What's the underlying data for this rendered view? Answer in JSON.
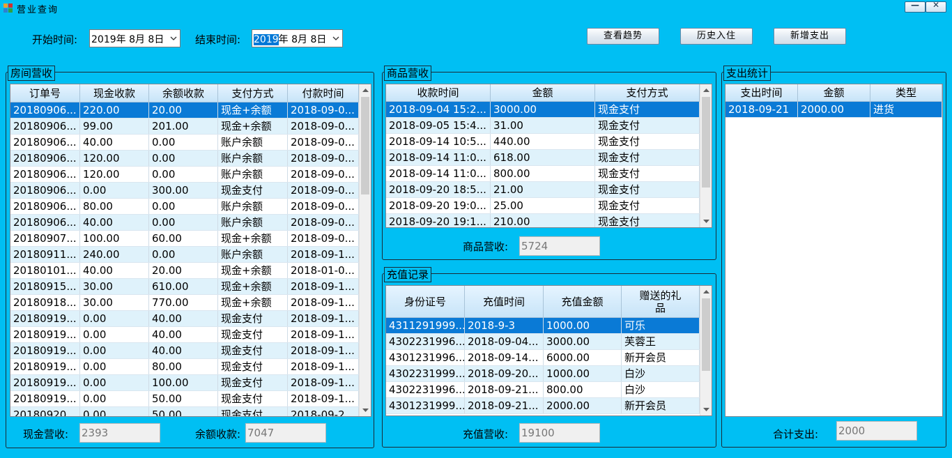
{
  "window": {
    "title": "营业查询",
    "icon": "app-icon",
    "min_icon": "minimize-icon",
    "close_icon": "close-icon"
  },
  "filters": {
    "start_label": "开始时间:",
    "start_value_sel": "",
    "start_value": "2019年  8月  8日",
    "end_label": "结束时间:",
    "end_value_sel": "2019",
    "end_value": "年  8月  8日"
  },
  "buttons": {
    "view_trend": "查看趋势",
    "history_checkin": "历史入住",
    "add_expense": "新增支出"
  },
  "room_revenue": {
    "title": "房间营收",
    "columns": [
      "订单号",
      "现金收款",
      "余额收款",
      "支付方式",
      "付款时间"
    ],
    "rows": [
      [
        "20180906...",
        "220.00",
        "20.00",
        "现金+余额",
        "2018-09-0..."
      ],
      [
        "20180906...",
        "99.00",
        "201.00",
        "现金+余额",
        "2018-09-0..."
      ],
      [
        "20180906...",
        "40.00",
        "0.00",
        "账户余额",
        "2018-09-0..."
      ],
      [
        "20180906...",
        "120.00",
        "0.00",
        "账户余额",
        "2018-09-0..."
      ],
      [
        "20180906...",
        "120.00",
        "0.00",
        "账户余额",
        "2018-09-0..."
      ],
      [
        "20180906...",
        "0.00",
        "300.00",
        "现金支付",
        "2018-09-0..."
      ],
      [
        "20180906...",
        "80.00",
        "0.00",
        "账户余额",
        "2018-09-0..."
      ],
      [
        "20180906...",
        "40.00",
        "0.00",
        "账户余额",
        "2018-09-0..."
      ],
      [
        "20180907...",
        "100.00",
        "60.00",
        "现金+余额",
        "2018-09-0..."
      ],
      [
        "20180911...",
        "240.00",
        "0.00",
        "账户余额",
        "2018-09-1..."
      ],
      [
        "20180101...",
        "40.00",
        "20.00",
        "现金+余额",
        "2018-01-0..."
      ],
      [
        "20180915...",
        "30.00",
        "610.00",
        "现金+余额",
        "2018-09-1..."
      ],
      [
        "20180918...",
        "30.00",
        "770.00",
        "现金+余额",
        "2018-09-1..."
      ],
      [
        "20180919...",
        "0.00",
        "40.00",
        "现金支付",
        "2018-09-1..."
      ],
      [
        "20180919...",
        "0.00",
        "40.00",
        "现金支付",
        "2018-09-1..."
      ],
      [
        "20180919...",
        "0.00",
        "40.00",
        "现金支付",
        "2018-09-1..."
      ],
      [
        "20180919...",
        "0.00",
        "80.00",
        "现金支付",
        "2018-09-1..."
      ],
      [
        "20180919...",
        "0.00",
        "100.00",
        "现金支付",
        "2018-09-1..."
      ],
      [
        "20180919...",
        "0.00",
        "50.00",
        "现金支付",
        "2018-09-1..."
      ],
      [
        "20180920...",
        "0.00",
        "50.00",
        "现金支付",
        "2018-09-2..."
      ]
    ],
    "cash_label": "现金营收:",
    "cash_value": "2393",
    "balance_label": "余额收款:",
    "balance_value": "7047"
  },
  "goods_revenue": {
    "title": "商品营收",
    "columns": [
      "收款时间",
      "金额",
      "支付方式"
    ],
    "rows": [
      [
        "2018-09-04 15:2...",
        "3000.00",
        "现金支付"
      ],
      [
        "2018-09-05 15:4...",
        "31.00",
        "现金支付"
      ],
      [
        "2018-09-14 10:5...",
        "440.00",
        "现金支付"
      ],
      [
        "2018-09-14 11:0...",
        "618.00",
        "现金支付"
      ],
      [
        "2018-09-14 11:0...",
        "800.00",
        "现金支付"
      ],
      [
        "2018-09-20 18:5...",
        "21.00",
        "现金支付"
      ],
      [
        "2018-09-20 19:0...",
        "25.00",
        "现金支付"
      ],
      [
        "2018-09-20 19:1...",
        "210.00",
        "现金支付"
      ]
    ],
    "total_label": "商品营收:",
    "total_value": "5724"
  },
  "recharge": {
    "title": "充值记录",
    "columns": [
      "身份证号",
      "充值时间",
      "充值金额",
      "赠送的礼品"
    ],
    "rows": [
      [
        "4311291999...",
        "2018-9-3",
        "1000.00",
        "可乐"
      ],
      [
        "4302231996...",
        "2018-09-04...",
        "3000.00",
        "芙蓉王"
      ],
      [
        "4301231996...",
        "2018-09-14...",
        "6000.00",
        "新开会员"
      ],
      [
        "4302231999...",
        "2018-09-20...",
        "1000.00",
        "白沙"
      ],
      [
        "4302231996...",
        "2018-09-21...",
        "800.00",
        "白沙"
      ],
      [
        "4301231999...",
        "2018-09-21...",
        "2000.00",
        "新开会员"
      ]
    ],
    "total_label": "充值营收:",
    "total_value": "19100"
  },
  "expenses": {
    "title": "支出统计",
    "columns": [
      "支出时间",
      "金额",
      "类型"
    ],
    "rows": [
      [
        "2018-09-21",
        "2000.00",
        "进货"
      ]
    ],
    "total_label": "合计支出:",
    "total_value": "2000"
  }
}
